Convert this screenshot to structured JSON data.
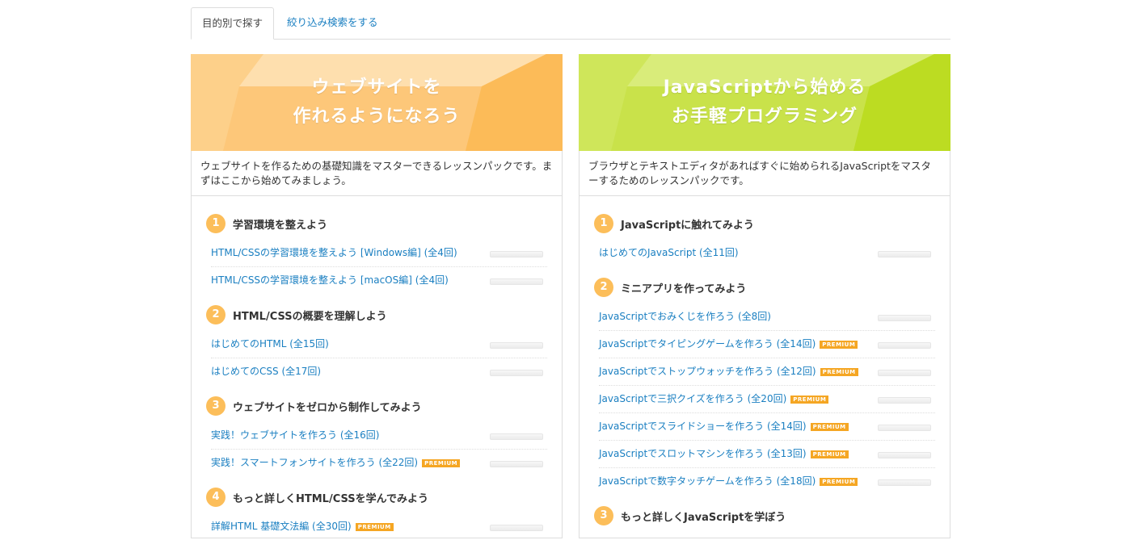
{
  "tabs": [
    {
      "label": "目的別で探す",
      "active": true
    },
    {
      "label": "絞り込み検索をする",
      "active": false
    }
  ],
  "colors": {
    "link": "#1a7fc1",
    "accent_orange": "#fcbe5a",
    "premium": "#f5a623",
    "banner_left": "#fdbe5e",
    "banner_right": "#c0de2c"
  },
  "cards": [
    {
      "banner_line1": "ウェブサイトを",
      "banner_line2": "作れるようになろう",
      "description": "ウェブサイトを作るための基礎知識をマスターできるレッスンパックです。まずはここから始めてみましょう。",
      "sections": [
        {
          "number": "1",
          "title": "学習環境を整えよう",
          "lessons": [
            {
              "title": "HTML/CSSの学習環境を整えよう [Windows編]",
              "count": "(全4回)",
              "premium": false
            },
            {
              "title": "HTML/CSSの学習環境を整えよう [macOS編]",
              "count": "(全4回)",
              "premium": false
            }
          ]
        },
        {
          "number": "2",
          "title": "HTML/CSSの概要を理解しよう",
          "lessons": [
            {
              "title": "はじめてのHTML",
              "count": "(全15回)",
              "premium": false
            },
            {
              "title": "はじめてのCSS",
              "count": "(全17回)",
              "premium": false
            }
          ]
        },
        {
          "number": "3",
          "title": "ウェブサイトをゼロから制作してみよう",
          "lessons": [
            {
              "title": "実践！ウェブサイトを作ろう",
              "count": "(全16回)",
              "premium": false
            },
            {
              "title": "実践！スマートフォンサイトを作ろう",
              "count": "(全22回)",
              "premium": true
            }
          ]
        },
        {
          "number": "4",
          "title": "もっと詳しくHTML/CSSを学んでみよう",
          "lessons": [
            {
              "title": "詳解HTML 基礎文法編",
              "count": "(全30回)",
              "premium": true
            }
          ]
        }
      ]
    },
    {
      "banner_line1": "JavaScriptから始める",
      "banner_line2": "お手軽プログラミング",
      "description": "ブラウザとテキストエディタがあればすぐに始められるJavaScriptをマスターするためのレッスンパックです。",
      "sections": [
        {
          "number": "1",
          "title": "JavaScriptに触れてみよう",
          "lessons": [
            {
              "title": "はじめてのJavaScript",
              "count": "(全11回)",
              "premium": false
            }
          ]
        },
        {
          "number": "2",
          "title": "ミニアプリを作ってみよう",
          "lessons": [
            {
              "title": "JavaScriptでおみくじを作ろう",
              "count": "(全8回)",
              "premium": false
            },
            {
              "title": "JavaScriptでタイピングゲームを作ろう",
              "count": "(全14回)",
              "premium": true
            },
            {
              "title": "JavaScriptでストップウォッチを作ろう",
              "count": "(全12回)",
              "premium": true
            },
            {
              "title": "JavaScriptで三択クイズを作ろう",
              "count": "(全20回)",
              "premium": true
            },
            {
              "title": "JavaScriptでスライドショーを作ろう",
              "count": "(全14回)",
              "premium": true
            },
            {
              "title": "JavaScriptでスロットマシンを作ろう",
              "count": "(全13回)",
              "premium": true
            },
            {
              "title": "JavaScriptで数字タッチゲームを作ろう",
              "count": "(全18回)",
              "premium": true
            }
          ]
        },
        {
          "number": "3",
          "title": "もっと詳しくJavaScriptを学ぼう",
          "lessons": []
        }
      ]
    }
  ],
  "premium_label": "PREMIUM"
}
